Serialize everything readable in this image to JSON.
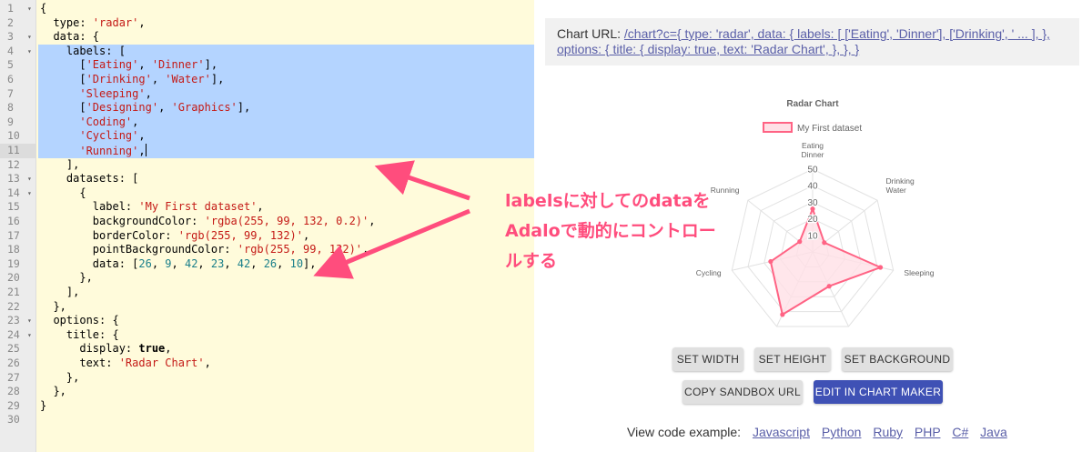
{
  "editor": {
    "active_line": 11,
    "selected_lines": [
      4,
      11
    ],
    "lines": [
      {
        "n": "1",
        "fold": true,
        "tokens": [
          [
            "{",
            "p"
          ]
        ]
      },
      {
        "n": "2",
        "fold": false,
        "tokens": [
          [
            "  type: ",
            "k"
          ],
          [
            "'radar'",
            "s"
          ],
          [
            ",",
            "p"
          ]
        ]
      },
      {
        "n": "3",
        "fold": true,
        "tokens": [
          [
            "  data: {",
            "k"
          ]
        ]
      },
      {
        "n": "4",
        "fold": true,
        "tokens": [
          [
            "    labels: [",
            "k"
          ]
        ]
      },
      {
        "n": "5",
        "fold": false,
        "tokens": [
          [
            "      [",
            "p"
          ],
          [
            "'Eating'",
            "s"
          ],
          [
            ", ",
            "p"
          ],
          [
            "'Dinner'",
            "s"
          ],
          [
            "],",
            "p"
          ]
        ]
      },
      {
        "n": "6",
        "fold": false,
        "tokens": [
          [
            "      [",
            "p"
          ],
          [
            "'Drinking'",
            "s"
          ],
          [
            ", ",
            "p"
          ],
          [
            "'Water'",
            "s"
          ],
          [
            "],",
            "p"
          ]
        ]
      },
      {
        "n": "7",
        "fold": false,
        "tokens": [
          [
            "      ",
            "p"
          ],
          [
            "'Sleeping'",
            "s"
          ],
          [
            ",",
            "p"
          ]
        ]
      },
      {
        "n": "8",
        "fold": false,
        "tokens": [
          [
            "      [",
            "p"
          ],
          [
            "'Designing'",
            "s"
          ],
          [
            ", ",
            "p"
          ],
          [
            "'Graphics'",
            "s"
          ],
          [
            "],",
            "p"
          ]
        ]
      },
      {
        "n": "9",
        "fold": false,
        "tokens": [
          [
            "      ",
            "p"
          ],
          [
            "'Coding'",
            "s"
          ],
          [
            ",",
            "p"
          ]
        ]
      },
      {
        "n": "10",
        "fold": false,
        "tokens": [
          [
            "      ",
            "p"
          ],
          [
            "'Cycling'",
            "s"
          ],
          [
            ",",
            "p"
          ]
        ]
      },
      {
        "n": "11",
        "fold": false,
        "tokens": [
          [
            "      ",
            "p"
          ],
          [
            "'Running'",
            "s"
          ],
          [
            ",",
            "p"
          ]
        ]
      },
      {
        "n": "12",
        "fold": false,
        "tokens": [
          [
            "    ],",
            "p"
          ]
        ]
      },
      {
        "n": "13",
        "fold": true,
        "tokens": [
          [
            "    datasets: [",
            "k"
          ]
        ]
      },
      {
        "n": "14",
        "fold": true,
        "tokens": [
          [
            "      {",
            "p"
          ]
        ]
      },
      {
        "n": "15",
        "fold": false,
        "tokens": [
          [
            "        label: ",
            "k"
          ],
          [
            "'My First dataset'",
            "s"
          ],
          [
            ",",
            "p"
          ]
        ]
      },
      {
        "n": "16",
        "fold": false,
        "tokens": [
          [
            "        backgroundColor: ",
            "k"
          ],
          [
            "'rgba(255, 99, 132, 0.2)'",
            "s"
          ],
          [
            ",",
            "p"
          ]
        ]
      },
      {
        "n": "17",
        "fold": false,
        "tokens": [
          [
            "        borderColor: ",
            "k"
          ],
          [
            "'rgb(255, 99, 132)'",
            "s"
          ],
          [
            ",",
            "p"
          ]
        ]
      },
      {
        "n": "18",
        "fold": false,
        "tokens": [
          [
            "        pointBackgroundColor: ",
            "k"
          ],
          [
            "'rgb(255, 99, 132)'",
            "s"
          ],
          [
            ",",
            "p"
          ]
        ]
      },
      {
        "n": "19",
        "fold": false,
        "tokens": [
          [
            "        data: [",
            "k"
          ],
          [
            "26",
            "n"
          ],
          [
            ", ",
            "p"
          ],
          [
            "9",
            "n"
          ],
          [
            ", ",
            "p"
          ],
          [
            "42",
            "n"
          ],
          [
            ", ",
            "p"
          ],
          [
            "23",
            "n"
          ],
          [
            ", ",
            "p"
          ],
          [
            "42",
            "n"
          ],
          [
            ", ",
            "p"
          ],
          [
            "26",
            "n"
          ],
          [
            ", ",
            "p"
          ],
          [
            "10",
            "n"
          ],
          [
            "],",
            "p"
          ]
        ]
      },
      {
        "n": "20",
        "fold": false,
        "tokens": [
          [
            "      },",
            "p"
          ]
        ]
      },
      {
        "n": "21",
        "fold": false,
        "tokens": [
          [
            "    ],",
            "p"
          ]
        ]
      },
      {
        "n": "22",
        "fold": false,
        "tokens": [
          [
            "  },",
            "p"
          ]
        ]
      },
      {
        "n": "23",
        "fold": true,
        "tokens": [
          [
            "  options: {",
            "k"
          ]
        ]
      },
      {
        "n": "24",
        "fold": true,
        "tokens": [
          [
            "    title: {",
            "k"
          ]
        ]
      },
      {
        "n": "25",
        "fold": false,
        "tokens": [
          [
            "      display: ",
            "k"
          ],
          [
            "true",
            "b"
          ],
          [
            ",",
            "p"
          ]
        ]
      },
      {
        "n": "26",
        "fold": false,
        "tokens": [
          [
            "      text: ",
            "k"
          ],
          [
            "'Radar Chart'",
            "s"
          ],
          [
            ",",
            "p"
          ]
        ]
      },
      {
        "n": "27",
        "fold": false,
        "tokens": [
          [
            "    },",
            "p"
          ]
        ]
      },
      {
        "n": "28",
        "fold": false,
        "tokens": [
          [
            "  },",
            "p"
          ]
        ]
      },
      {
        "n": "29",
        "fold": false,
        "tokens": [
          [
            "}",
            "p"
          ]
        ]
      },
      {
        "n": "30",
        "fold": false,
        "tokens": []
      }
    ]
  },
  "url_box": {
    "label": "Chart URL: ",
    "link_line1": "/chart?c={ type: 'radar', data: { labels: [ ['Eating', 'Dinner'], ['Drinking', ' ... ], },",
    "link_line2": "options: { title: { display: true, text: 'Radar Chart', }, }, }"
  },
  "chart_data": {
    "type": "radar",
    "title": "Radar Chart",
    "labels": [
      [
        "Eating",
        "Dinner"
      ],
      [
        "Drinking",
        "Water"
      ],
      [
        "Sleeping"
      ],
      [
        "Designing",
        "Graphics"
      ],
      [
        "Coding"
      ],
      [
        "Cycling"
      ],
      [
        "Running"
      ]
    ],
    "series": [
      {
        "name": "My First dataset",
        "values": [
          26,
          9,
          42,
          23,
          42,
          26,
          10
        ],
        "fill": "#ffe0e6",
        "stroke": "#ff6384",
        "point": "#ff6384"
      }
    ],
    "r_min": 0,
    "r_max": 50,
    "ticks": [
      10,
      20,
      30,
      40,
      50
    ],
    "grid": true,
    "legend": "top"
  },
  "buttons": {
    "set_width": "SET WIDTH",
    "set_height": "SET HEIGHT",
    "set_background": "SET BACKGROUND",
    "copy_sandbox_url": "COPY SANDBOX URL",
    "edit_in_chart_maker": "EDIT IN CHART MAKER"
  },
  "code_examples": {
    "label": "View code example:",
    "links": [
      "Javascript",
      "Python",
      "Ruby",
      "PHP",
      "C#",
      "Java"
    ]
  },
  "annotation": {
    "text": "labelsに対してのdataをAdaloで動的にコントロールする",
    "color": "#ff4d7d"
  }
}
